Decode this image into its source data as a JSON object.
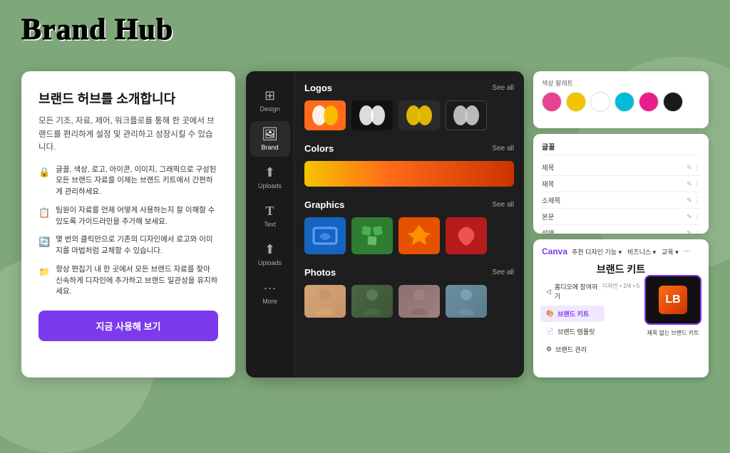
{
  "title": "Brand Hub",
  "background_color": "#7fa87a",
  "main_card": {
    "heading": "브랜드 허브를 소개합니다",
    "description": "모든 기조, 자료, 제어, 워크플로를 통해 한 곳에서 브랜드를 편리하게 설정 및 관리하고 성장시킬 수 있습니다.",
    "features": [
      {
        "icon": "🔒",
        "text": "글꼴, 색상, 로고, 아이콘, 이미지, 그래픽으로 구성된 모든 브랜드 자료를 이제는 브랜드 키트에서 간편하게 관리하세요."
      },
      {
        "icon": "📋",
        "text": "팀원이 자료를 언제 어떻게 사용하는지 잘 이해할 수 있도록 가이드라인을 추가해 보세요."
      },
      {
        "icon": "🔄",
        "text": "몇 번의 클릭만으로 기존의 디자인에서 로고와 이미지를 마법처럼 교체할 수 있습니다."
      },
      {
        "icon": "📁",
        "text": "항상 편집기 내 한 곳에서 모든 브랜드 자료를 찾아 신속하게 디자인에 추가하고 브랜드 일관성을 유지하세요."
      }
    ],
    "cta_label": "지금 사용해 보기"
  },
  "center_panel": {
    "sidebar_items": [
      {
        "icon": "⊞",
        "label": "Design",
        "active": false
      },
      {
        "icon": "🖼",
        "label": "Brand",
        "active": true
      },
      {
        "icon": "⬆",
        "label": "Uploads",
        "active": false
      },
      {
        "icon": "T",
        "label": "Text",
        "active": false
      },
      {
        "icon": "⬆",
        "label": "Uploads",
        "active": false
      },
      {
        "icon": "···",
        "label": "More",
        "active": false
      }
    ],
    "sections": {
      "logos": {
        "title": "Logos",
        "see_all": "See all"
      },
      "colors": {
        "title": "Colors",
        "see_all": "See all"
      },
      "graphics": {
        "title": "Graphics",
        "see_all": "See all"
      },
      "photos": {
        "title": "Photos",
        "see_all": "See all"
      }
    }
  },
  "right_panel": {
    "swatches": {
      "colors": [
        "#e84393",
        "#f5c400",
        "#ffffff",
        "#00bcd4",
        "#e91e8c",
        "#1a1a1a"
      ]
    },
    "typography": {
      "title": "글꼴",
      "rows": [
        {
          "name": "제목",
          "style": ""
        },
        {
          "name": "재목",
          "style": ""
        },
        {
          "name": "소제목",
          "style": ""
        },
        {
          "name": "본문",
          "style": ""
        },
        {
          "name": "설명",
          "style": ""
        }
      ]
    },
    "brand_kit": {
      "nav_logo": "Canva",
      "nav_items": [
        "추천 디자인 기능 ▾",
        "비즈니스 ▾",
        "교육 ▾",
        "···"
      ],
      "title": "브랜드 키트",
      "subtitle": "디자인 • 2/4 • 5",
      "sidebar_items": [
        {
          "label": "홈디오에 참여하기",
          "icon": "◁",
          "active": false
        },
        {
          "label": "브랜드 키트",
          "icon": "🎨",
          "active": true
        },
        {
          "label": "브랜드 템플릿",
          "icon": "📄",
          "active": false
        },
        {
          "label": "브랜드 관리",
          "icon": "⚙",
          "active": false
        }
      ],
      "thumb_label": "제목 없는 브랜드 키트"
    }
  }
}
